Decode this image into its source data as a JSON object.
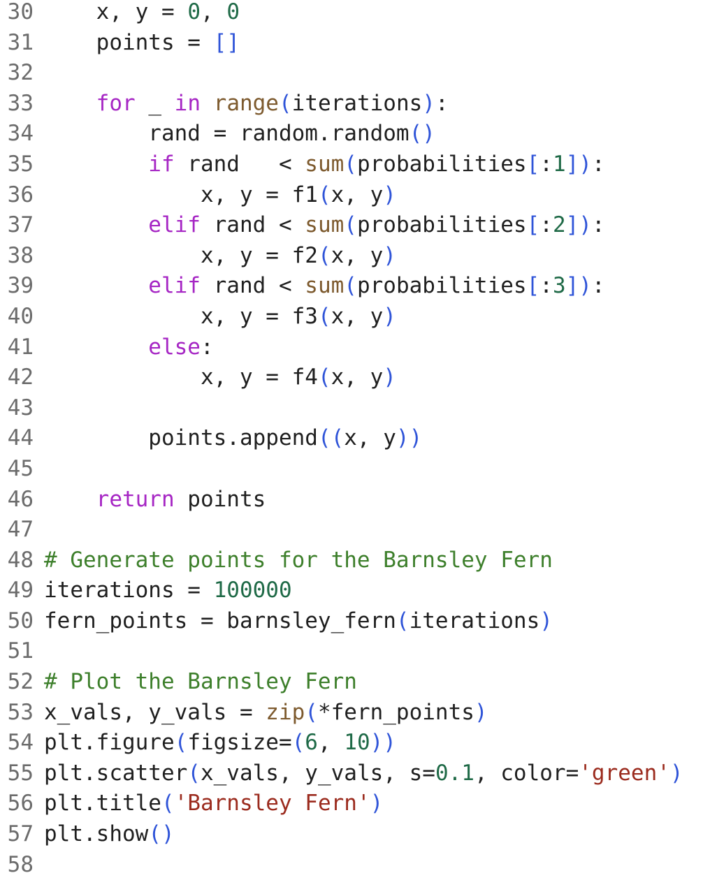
{
  "editor": {
    "colors": {
      "keyword": "#a626c4",
      "builtin": "#7d5a2e",
      "number": "#1f6a47",
      "string": "#9b2b1e",
      "comment": "#3d7f2b",
      "bracket": "#2f54d8",
      "text": "#1f1f1f",
      "line_number": "#6c6c6c"
    },
    "lines": [
      {
        "n": "30",
        "tokens": [
          [
            "id",
            "    x, y = "
          ],
          [
            "num",
            "0"
          ],
          [
            "id",
            ", "
          ],
          [
            "num",
            "0"
          ]
        ]
      },
      {
        "n": "31",
        "tokens": [
          [
            "id",
            "    points = "
          ],
          [
            "br",
            "[]"
          ]
        ]
      },
      {
        "n": "32",
        "tokens": []
      },
      {
        "n": "33",
        "tokens": [
          [
            "kw",
            "    for"
          ],
          [
            "id",
            " _ "
          ],
          [
            "kw",
            "in"
          ],
          [
            "id",
            " "
          ],
          [
            "bi",
            "range"
          ],
          [
            "br",
            "("
          ],
          [
            "id",
            "iterations"
          ],
          [
            "br",
            ")"
          ],
          [
            "id",
            ":"
          ]
        ]
      },
      {
        "n": "34",
        "tokens": [
          [
            "id",
            "        rand = random.random"
          ],
          [
            "br",
            "()"
          ]
        ]
      },
      {
        "n": "35",
        "tokens": [
          [
            "kw",
            "        if"
          ],
          [
            "id",
            " rand   < "
          ],
          [
            "bi",
            "sum"
          ],
          [
            "br",
            "("
          ],
          [
            "id",
            "probabilities"
          ],
          [
            "br",
            "["
          ],
          [
            "id",
            ":"
          ],
          [
            "num",
            "1"
          ],
          [
            "br",
            "])"
          ],
          [
            "id",
            ":"
          ]
        ]
      },
      {
        "n": "36",
        "tokens": [
          [
            "id",
            "            x, y = f1"
          ],
          [
            "br",
            "("
          ],
          [
            "id",
            "x, y"
          ],
          [
            "br",
            ")"
          ]
        ]
      },
      {
        "n": "37",
        "tokens": [
          [
            "kw",
            "        elif"
          ],
          [
            "id",
            " rand < "
          ],
          [
            "bi",
            "sum"
          ],
          [
            "br",
            "("
          ],
          [
            "id",
            "probabilities"
          ],
          [
            "br",
            "["
          ],
          [
            "id",
            ":"
          ],
          [
            "num",
            "2"
          ],
          [
            "br",
            "])"
          ],
          [
            "id",
            ":"
          ]
        ]
      },
      {
        "n": "38",
        "tokens": [
          [
            "id",
            "            x, y = f2"
          ],
          [
            "br",
            "("
          ],
          [
            "id",
            "x, y"
          ],
          [
            "br",
            ")"
          ]
        ]
      },
      {
        "n": "39",
        "tokens": [
          [
            "kw",
            "        elif"
          ],
          [
            "id",
            " rand < "
          ],
          [
            "bi",
            "sum"
          ],
          [
            "br",
            "("
          ],
          [
            "id",
            "probabilities"
          ],
          [
            "br",
            "["
          ],
          [
            "id",
            ":"
          ],
          [
            "num",
            "3"
          ],
          [
            "br",
            "])"
          ],
          [
            "id",
            ":"
          ]
        ]
      },
      {
        "n": "40",
        "tokens": [
          [
            "id",
            "            x, y = f3"
          ],
          [
            "br",
            "("
          ],
          [
            "id",
            "x, y"
          ],
          [
            "br",
            ")"
          ]
        ]
      },
      {
        "n": "41",
        "tokens": [
          [
            "kw",
            "        else"
          ],
          [
            "id",
            ":"
          ]
        ]
      },
      {
        "n": "42",
        "tokens": [
          [
            "id",
            "            x, y = f4"
          ],
          [
            "br",
            "("
          ],
          [
            "id",
            "x, y"
          ],
          [
            "br",
            ")"
          ]
        ]
      },
      {
        "n": "43",
        "tokens": []
      },
      {
        "n": "44",
        "tokens": [
          [
            "id",
            "        points.append"
          ],
          [
            "br",
            "(("
          ],
          [
            "id",
            "x, y"
          ],
          [
            "br",
            "))"
          ]
        ]
      },
      {
        "n": "45",
        "tokens": []
      },
      {
        "n": "46",
        "tokens": [
          [
            "kw",
            "    return"
          ],
          [
            "id",
            " points"
          ]
        ]
      },
      {
        "n": "47",
        "tokens": []
      },
      {
        "n": "48",
        "tokens": [
          [
            "cm",
            "# Generate points for the Barnsley Fern"
          ]
        ]
      },
      {
        "n": "49",
        "tokens": [
          [
            "id",
            "iterations = "
          ],
          [
            "num",
            "100000"
          ]
        ]
      },
      {
        "n": "50",
        "tokens": [
          [
            "id",
            "fern_points = barnsley_fern"
          ],
          [
            "br",
            "("
          ],
          [
            "id",
            "iterations"
          ],
          [
            "br",
            ")"
          ]
        ]
      },
      {
        "n": "51",
        "tokens": []
      },
      {
        "n": "52",
        "tokens": [
          [
            "cm",
            "# Plot the Barnsley Fern"
          ]
        ]
      },
      {
        "n": "53",
        "tokens": [
          [
            "id",
            "x_vals, y_vals = "
          ],
          [
            "bi",
            "zip"
          ],
          [
            "br",
            "("
          ],
          [
            "id",
            "*fern_points"
          ],
          [
            "br",
            ")"
          ]
        ]
      },
      {
        "n": "54",
        "tokens": [
          [
            "id",
            "plt.figure"
          ],
          [
            "br",
            "("
          ],
          [
            "id",
            "figsize="
          ],
          [
            "br",
            "("
          ],
          [
            "num",
            "6"
          ],
          [
            "id",
            ", "
          ],
          [
            "num",
            "10"
          ],
          [
            "br",
            "))"
          ]
        ]
      },
      {
        "n": "55",
        "tokens": [
          [
            "id",
            "plt.scatter"
          ],
          [
            "br",
            "("
          ],
          [
            "id",
            "x_vals, y_vals, s="
          ],
          [
            "num",
            "0.1"
          ],
          [
            "id",
            ", color="
          ],
          [
            "str",
            "'green'"
          ],
          [
            "br",
            ")"
          ]
        ]
      },
      {
        "n": "56",
        "tokens": [
          [
            "id",
            "plt.title"
          ],
          [
            "br",
            "("
          ],
          [
            "str",
            "'Barnsley Fern'"
          ],
          [
            "br",
            ")"
          ]
        ]
      },
      {
        "n": "57",
        "tokens": [
          [
            "id",
            "plt.show"
          ],
          [
            "br",
            "()"
          ]
        ]
      },
      {
        "n": "58",
        "tokens": []
      }
    ]
  }
}
